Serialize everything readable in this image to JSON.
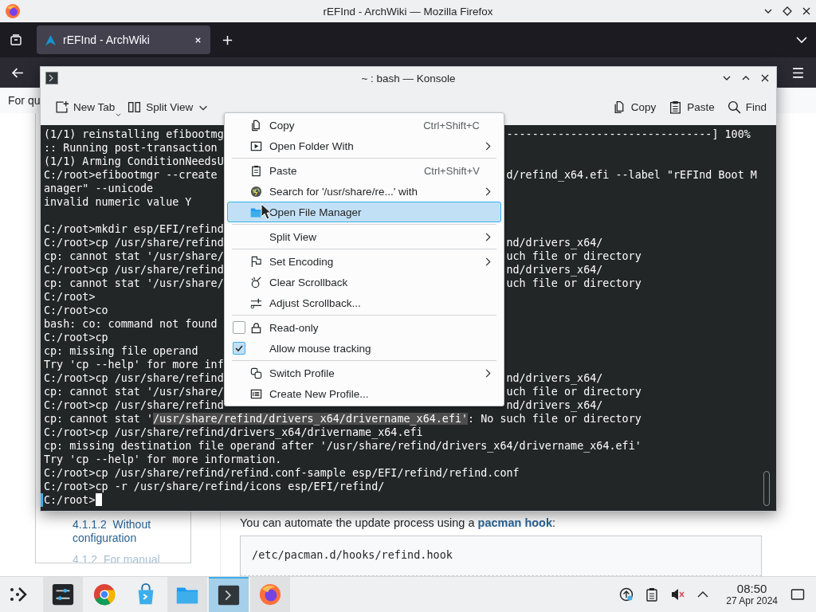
{
  "browser": {
    "title": "rEFInd - ArchWiki — Mozilla Firefox",
    "tabs": [
      {
        "label": "rEFInd - ArchWiki",
        "selected": true
      }
    ],
    "page": {
      "top_text": "For qu",
      "toc": [
        {
          "number": "4.1.1.2",
          "label": "Without configuration",
          "faded": false
        },
        {
          "number": "4.1.2",
          "label": "For manual",
          "faded": true
        }
      ],
      "paragraph": {
        "before": "You can automate the update process using a ",
        "link": "pacman hook",
        "after": ":"
      },
      "code": "/etc/pacman.d/hooks/refind.hook"
    }
  },
  "konsole": {
    "title": "~ : bash — Konsole",
    "toolbar_left": [
      {
        "label": "New Tab"
      },
      {
        "label": "Split View"
      }
    ],
    "toolbar_right": [
      {
        "label": "Copy"
      },
      {
        "label": "Paste"
      },
      {
        "label": "Find"
      }
    ],
    "lines": [
      {
        "kind": "split",
        "left": "(1/1) reinstalling efibootmg",
        "right": "--------------------------------] 100%"
      },
      {
        "kind": "split",
        "left": ":: Running post-transaction"
      },
      {
        "kind": "split",
        "left": "(1/1) Arming ConditionNeedsU"
      },
      {
        "kind": "split",
        "left": "C:/root>efibootmgr --create",
        "right": "d/refind_x64.efi --label \"rEFInd Boot M"
      },
      {
        "kind": "split",
        "left": "anager\" --unicode"
      },
      {
        "kind": "split",
        "left": "invalid numeric value Y"
      },
      {
        "kind": "split"
      },
      {
        "kind": "split",
        "left": "C:/root>mkdir esp/EFI/refind"
      },
      {
        "kind": "split",
        "left": "C:/root>cp /usr/share/refind",
        "right": "nd/drivers_x64/"
      },
      {
        "kind": "split",
        "left": "cp: cannot stat '/usr/share/",
        "right": "uch file or directory"
      },
      {
        "kind": "split",
        "left": "C:/root>cp /usr/share/refind",
        "right": "nd/drivers_x64/"
      },
      {
        "kind": "split",
        "left": "cp: cannot stat '/usr/share/",
        "right": "uch file or directory"
      },
      {
        "kind": "split",
        "left": "C:/root>"
      },
      {
        "kind": "split",
        "left": "C:/root>co"
      },
      {
        "kind": "split",
        "left": "bash: co: command not found"
      },
      {
        "kind": "split",
        "left": "C:/root>cp"
      },
      {
        "kind": "split",
        "left": "cp: missing file operand"
      },
      {
        "kind": "split",
        "left": "Try 'cp --help' for more inf"
      },
      {
        "kind": "split",
        "left": "C:/root>cp /usr/share/refind",
        "right": "nd/drivers_x64/"
      },
      {
        "kind": "split",
        "left": "cp: cannot stat '/usr/share/",
        "right": "uch file or directory"
      },
      {
        "kind": "split",
        "left": "C:/root>cp /usr/share/refind",
        "right": "nd/drivers_x64/"
      },
      {
        "kind": "full",
        "segments": [
          {
            "text": "cp: cannot stat '",
            "selected": false
          },
          {
            "text": "/usr/share/refind/drivers_x64/drivername_x64.efi'",
            "selected": true
          },
          {
            "text": ": No such file or directory",
            "selected": false
          }
        ]
      },
      {
        "kind": "full",
        "segments": [
          {
            "text": "C:/root>cp /usr/share/refind/drivers_x64/drivername_x64.efi",
            "selected": false
          }
        ]
      },
      {
        "kind": "full",
        "segments": [
          {
            "text": "cp: missing destination file operand after '/usr/share/refind/drivers_x64/drivername_x64.efi'",
            "selected": false
          }
        ]
      },
      {
        "kind": "full",
        "segments": [
          {
            "text": "Try 'cp --help' for more information.",
            "selected": false
          }
        ]
      },
      {
        "kind": "full",
        "segments": [
          {
            "text": "C:/root>cp /usr/share/refind/refind.conf-sample esp/EFI/refind/refind.conf",
            "selected": false
          }
        ]
      },
      {
        "kind": "full",
        "segments": [
          {
            "text": "C:/root>cp -r /usr/share/refind/icons esp/EFI/refind/",
            "selected": false
          }
        ]
      },
      {
        "kind": "prompt",
        "segments": [
          {
            "text": "C:/root>",
            "selected": false
          }
        ]
      }
    ]
  },
  "context_menu": {
    "items": [
      {
        "kind": "action",
        "label": "Copy",
        "shortcut": "Ctrl+Shift+C",
        "submenu": false,
        "selected": false
      },
      {
        "kind": "action",
        "label": "Open Folder With",
        "submenu": true,
        "selected": false
      },
      {
        "kind": "separator"
      },
      {
        "kind": "action",
        "label": "Paste",
        "shortcut": "Ctrl+Shift+V",
        "submenu": false,
        "selected": false
      },
      {
        "kind": "action",
        "label": "Search for '/usr/share/re...' with",
        "submenu": true,
        "selected": false
      },
      {
        "kind": "action",
        "label": "Open File Manager",
        "submenu": false,
        "selected": true
      },
      {
        "kind": "separator"
      },
      {
        "kind": "action",
        "label": "Split View",
        "submenu": true,
        "selected": false
      },
      {
        "kind": "separator"
      },
      {
        "kind": "action",
        "label": "Set Encoding",
        "submenu": true,
        "selected": false
      },
      {
        "kind": "action",
        "label": "Clear Scrollback",
        "submenu": false,
        "selected": false
      },
      {
        "kind": "action",
        "label": "Adjust Scrollback...",
        "submenu": false,
        "selected": false
      },
      {
        "kind": "separator"
      },
      {
        "kind": "check",
        "label": "Read-only",
        "checked": false
      },
      {
        "kind": "check",
        "label": "Allow mouse tracking",
        "checked": true
      },
      {
        "kind": "separator"
      },
      {
        "kind": "action",
        "label": "Switch Profile",
        "submenu": true,
        "selected": false
      },
      {
        "kind": "action",
        "label": "Create New Profile...",
        "submenu": false,
        "selected": false
      }
    ]
  },
  "taskbar": {
    "apps": [
      {
        "open": true,
        "selected": false
      },
      {
        "open": false,
        "selected": false
      },
      {
        "open": false,
        "selected": false
      },
      {
        "open": true,
        "selected": false
      },
      {
        "open": true,
        "selected": true
      },
      {
        "open": true,
        "selected": false
      }
    ],
    "clock": {
      "time": "08:50",
      "date": "27 Apr 2024"
    }
  }
}
